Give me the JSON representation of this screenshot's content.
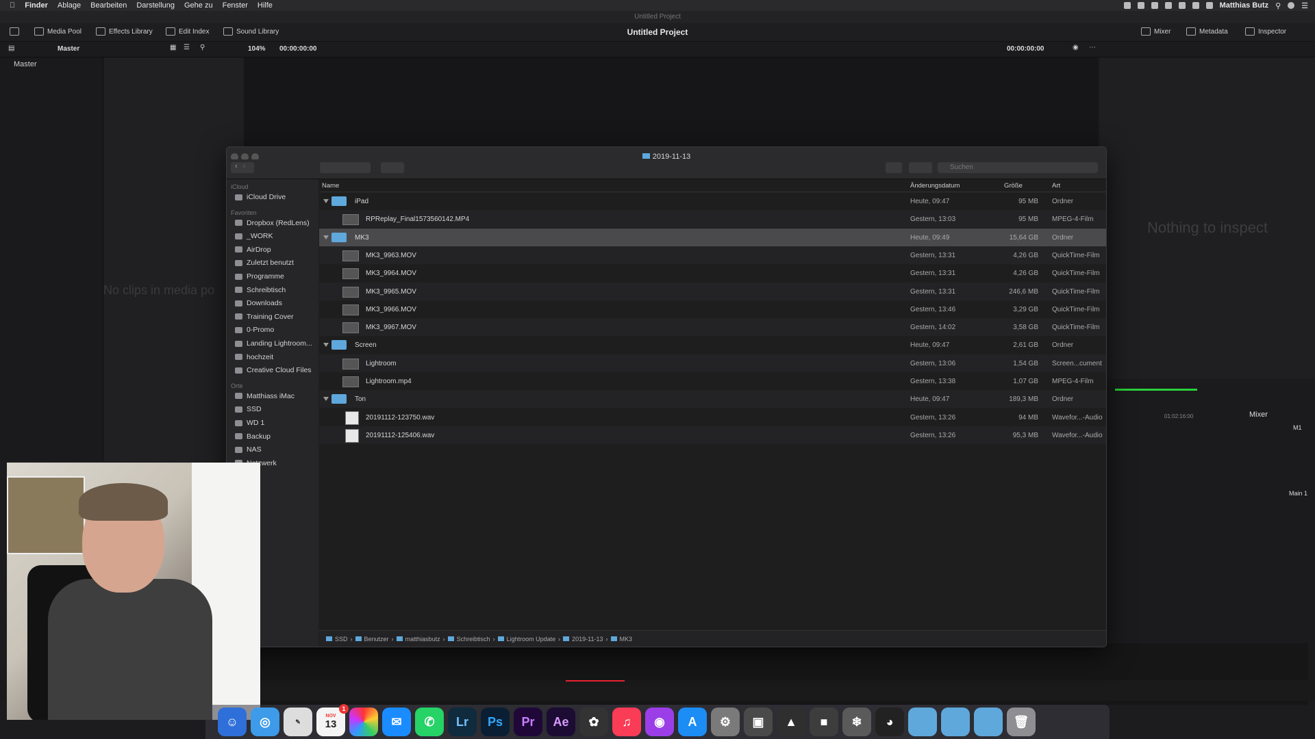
{
  "menubar": {
    "app": "Finder",
    "items": [
      "Ablage",
      "Bearbeiten",
      "Darstellung",
      "Gehe zu",
      "Fenster",
      "Hilfe"
    ],
    "user": "Matthias Butz"
  },
  "resolve": {
    "window_title": "Untitled Project",
    "project_title": "Untitled Project",
    "tabs": [
      "Media Pool",
      "Effects Library",
      "Edit Index",
      "Sound Library"
    ],
    "right_tabs": [
      "Mixer",
      "Metadata",
      "Inspector"
    ],
    "bin": "Master",
    "zoom": "104%",
    "timecode_left": "00:00:00:00",
    "timecode_right": "00:00:00:00",
    "master_label": "Master",
    "no_clips": "No clips in media po",
    "nothing_to_inspect": "Nothing to inspect",
    "mixer_label": "Mixer",
    "m1": "M1",
    "main1": "Main 1",
    "tl_time": "01:02:16:00"
  },
  "finder": {
    "title": "2019-11-13",
    "search_placeholder": "Suchen",
    "columns": {
      "name": "Name",
      "date": "Änderungsdatum",
      "size": "Größe",
      "kind": "Art"
    },
    "sidebar": {
      "icloud_header": "iCloud",
      "icloud_items": [
        "iCloud Drive"
      ],
      "fav_header": "Favoriten",
      "fav_items": [
        "Dropbox (RedLens)",
        "_WORK",
        "AirDrop",
        "Zuletzt benutzt",
        "Programme",
        "Schreibtisch",
        "Downloads",
        "Training Cover",
        "0-Promo",
        "Landing Lightroom...",
        "hochzeit",
        "Creative Cloud Files"
      ],
      "places_header": "Orte",
      "places_items": [
        "Matthiass iMac",
        "SSD",
        "WD 1",
        "Backup",
        "NAS",
        "Netzwerk"
      ]
    },
    "rows": [
      {
        "type": "folder",
        "level": 0,
        "name": "iPad",
        "date": "Heute, 09:47",
        "size": "95 MB",
        "kind": "Ordner"
      },
      {
        "type": "video",
        "level": 1,
        "name": "RPReplay_Final1573560142.MP4",
        "date": "Gestern, 13:03",
        "size": "95 MB",
        "kind": "MPEG-4-Film"
      },
      {
        "type": "folder",
        "level": 0,
        "name": "MK3",
        "date": "Heute, 09:49",
        "size": "15,64 GB",
        "kind": "Ordner",
        "selected": true
      },
      {
        "type": "video",
        "level": 1,
        "name": "MK3_9963.MOV",
        "date": "Gestern, 13:31",
        "size": "4,26 GB",
        "kind": "QuickTime-Film"
      },
      {
        "type": "video",
        "level": 1,
        "name": "MK3_9964.MOV",
        "date": "Gestern, 13:31",
        "size": "4,26 GB",
        "kind": "QuickTime-Film"
      },
      {
        "type": "video",
        "level": 1,
        "name": "MK3_9965.MOV",
        "date": "Gestern, 13:31",
        "size": "246,6 MB",
        "kind": "QuickTime-Film"
      },
      {
        "type": "video",
        "level": 1,
        "name": "MK3_9966.MOV",
        "date": "Gestern, 13:46",
        "size": "3,29 GB",
        "kind": "QuickTime-Film"
      },
      {
        "type": "video",
        "level": 1,
        "name": "MK3_9967.MOV",
        "date": "Gestern, 14:02",
        "size": "3,58 GB",
        "kind": "QuickTime-Film"
      },
      {
        "type": "folder",
        "level": 0,
        "name": "Screen",
        "date": "Heute, 09:47",
        "size": "2,61 GB",
        "kind": "Ordner"
      },
      {
        "type": "video",
        "level": 1,
        "name": "Lightroom",
        "date": "Gestern, 13:06",
        "size": "1,54 GB",
        "kind": "Screen...cument"
      },
      {
        "type": "video",
        "level": 1,
        "name": "Lightroom.mp4",
        "date": "Gestern, 13:38",
        "size": "1,07 GB",
        "kind": "MPEG-4-Film"
      },
      {
        "type": "folder",
        "level": 0,
        "name": "Ton",
        "date": "Heute, 09:47",
        "size": "189,3 MB",
        "kind": "Ordner"
      },
      {
        "type": "audio",
        "level": 1,
        "name": "20191112-123750.wav",
        "date": "Gestern, 13:26",
        "size": "94 MB",
        "kind": "Wavefor...-Audio"
      },
      {
        "type": "audio",
        "level": 1,
        "name": "20191112-125406.wav",
        "date": "Gestern, 13:26",
        "size": "95,3 MB",
        "kind": "Wavefor...-Audio"
      }
    ],
    "path": [
      "SSD",
      "Benutzer",
      "matthiasbutz",
      "Schreibtisch",
      "Lightroom Update",
      "2019-11-13",
      "MK3"
    ]
  },
  "dock": {
    "calendar_month": "NOV",
    "calendar_day": "13",
    "badge": "1",
    "labels": [
      "Lr",
      "Ps",
      "Pr",
      "Ae"
    ]
  }
}
